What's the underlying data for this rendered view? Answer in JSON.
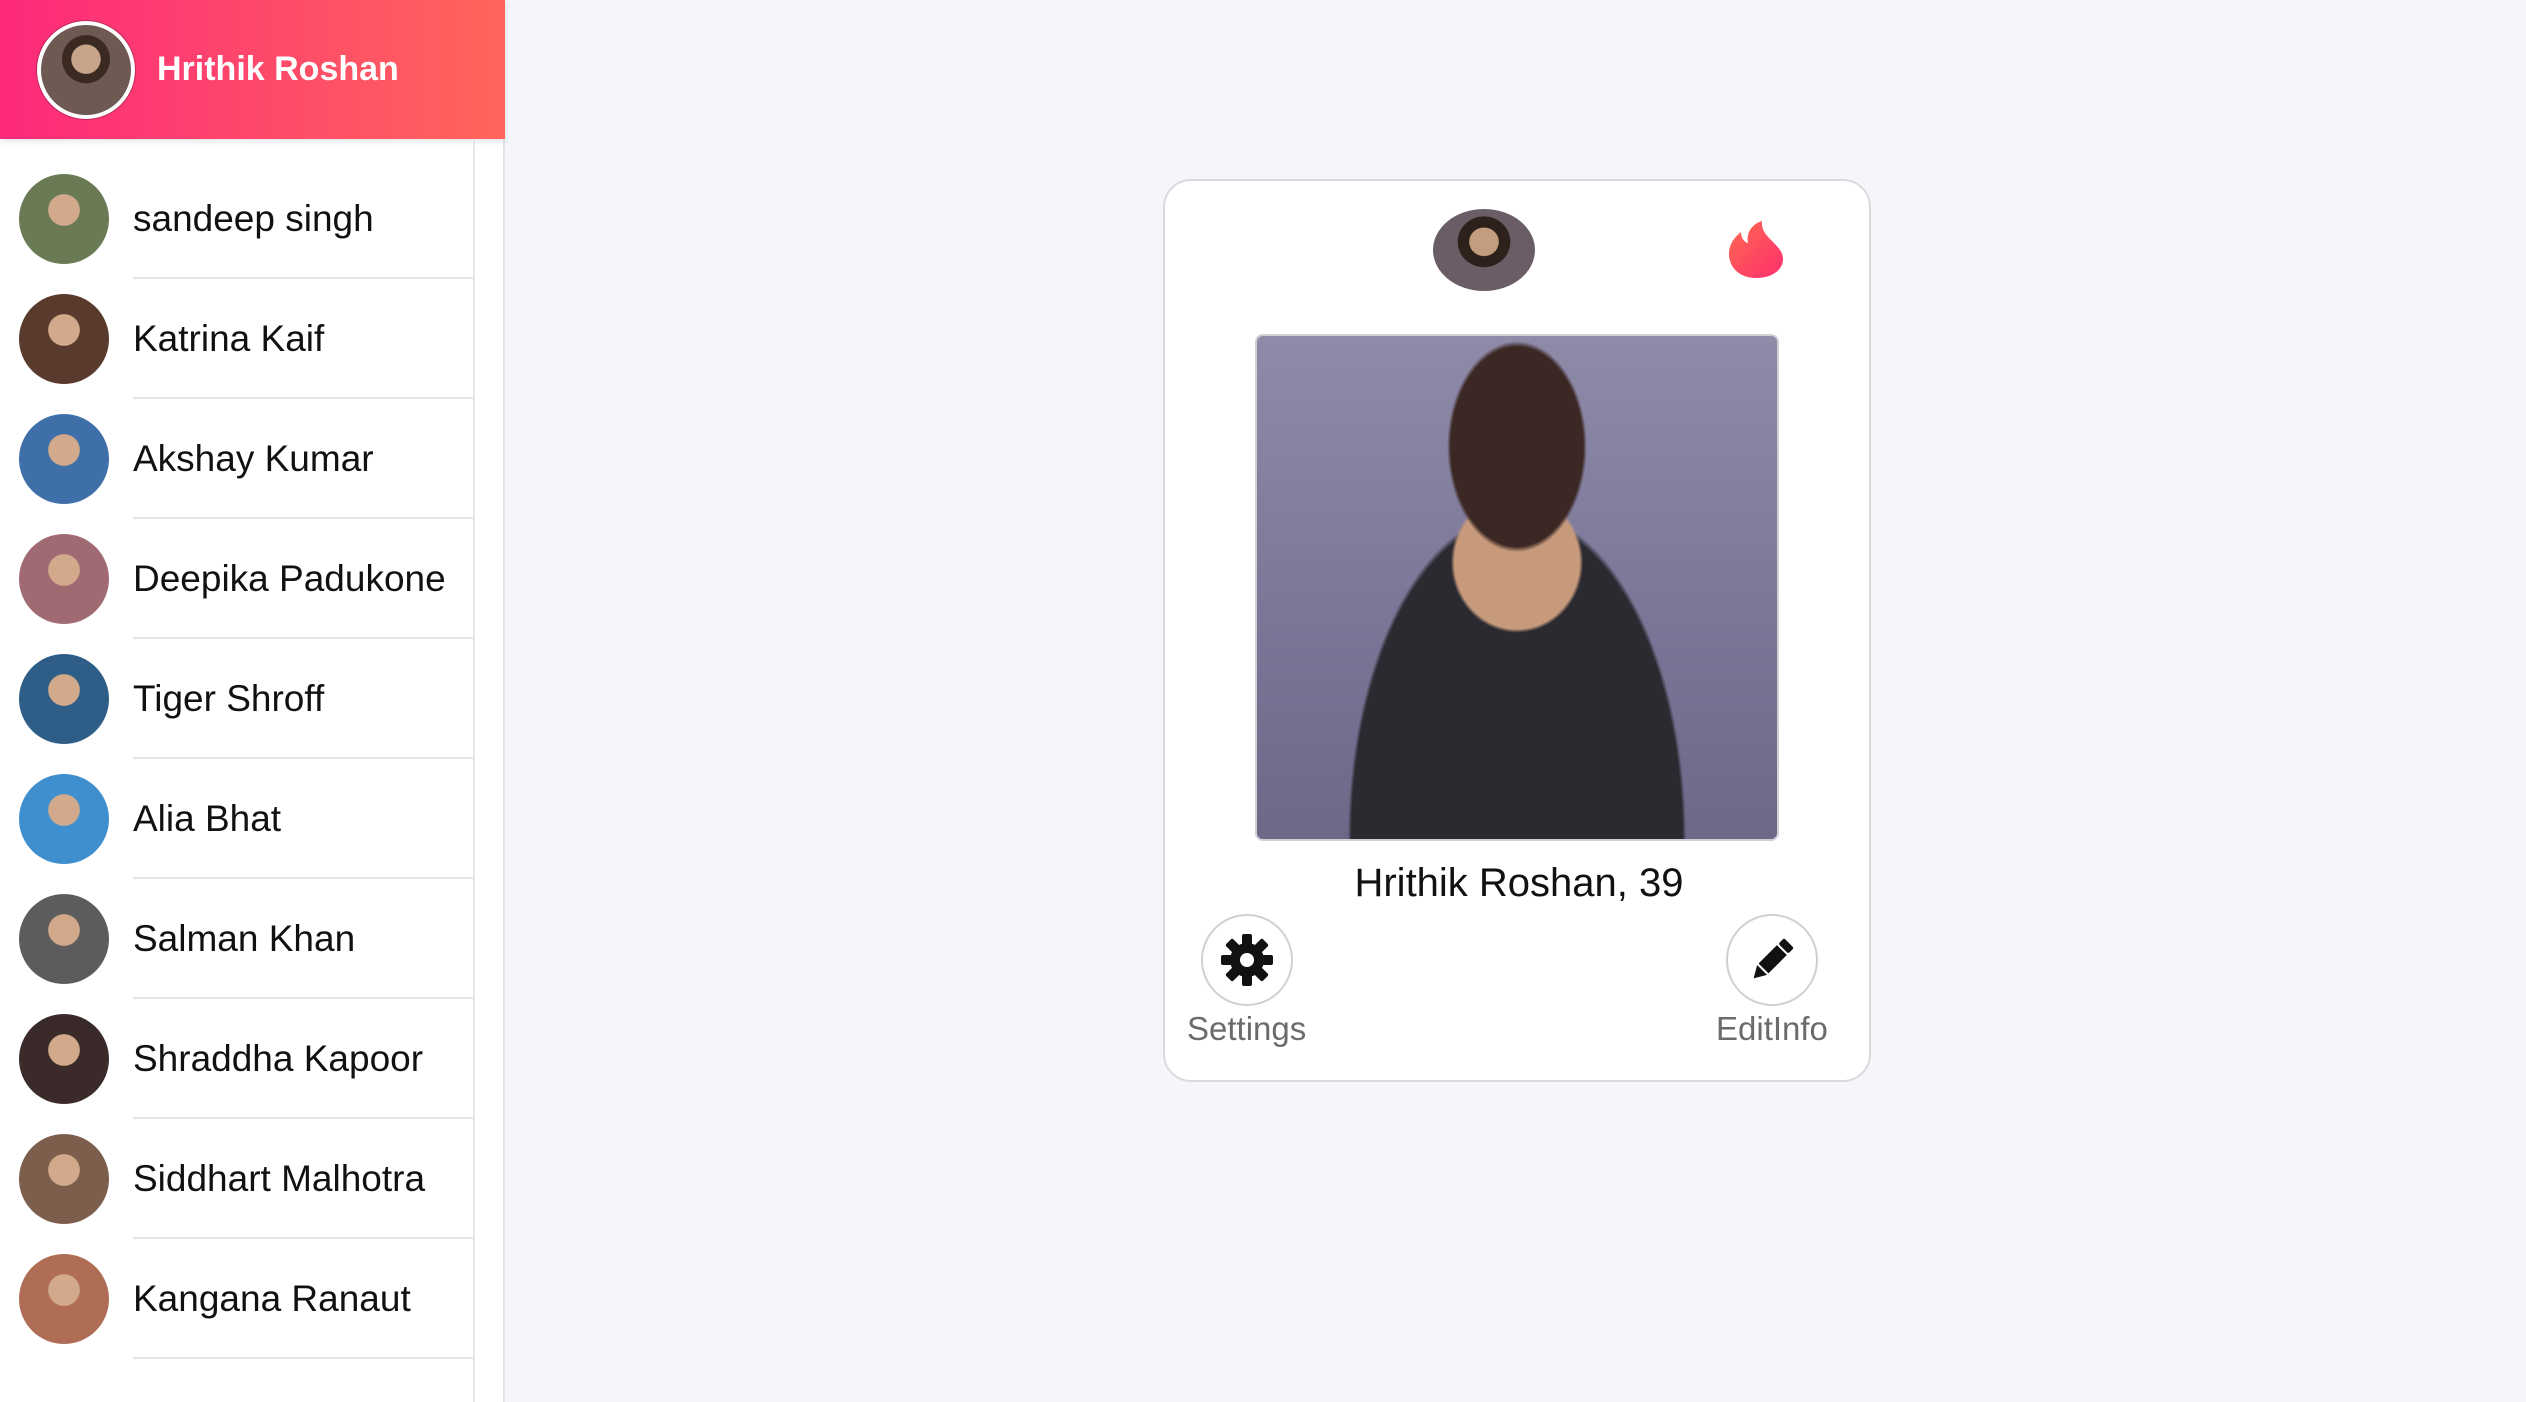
{
  "user": {
    "name": "Hrithik Roshan",
    "avatar_icon": "profile-avatar"
  },
  "contacts": [
    {
      "name": "sandeep singh",
      "color": "#6a7a55"
    },
    {
      "name": "Katrina Kaif",
      "color": "#5a3a2c"
    },
    {
      "name": "Akshay Kumar",
      "color": "#3f6fa8"
    },
    {
      "name": "Deepika Padukone",
      "color": "#a06a72"
    },
    {
      "name": "Tiger Shroff",
      "color": "#2e5e88"
    },
    {
      "name": "Alia Bhat",
      "color": "#3f8fcf"
    },
    {
      "name": "Salman Khan",
      "color": "#5c5c5c"
    },
    {
      "name": "Shraddha Kapoor",
      "color": "#3a2b2a"
    },
    {
      "name": "Siddhart Malhotra",
      "color": "#7d5e4c"
    },
    {
      "name": "Kangana Ranaut",
      "color": "#b06d55"
    }
  ],
  "profile": {
    "title": "Hrithik Roshan, 39",
    "brand_icon": "flame-icon",
    "actions": {
      "settings_label": "Settings",
      "edit_label": "EditInfo"
    }
  },
  "colors": {
    "header_gradient_start": "#fd297b",
    "header_gradient_end": "#ff655b",
    "background": "#f5f6fa"
  }
}
